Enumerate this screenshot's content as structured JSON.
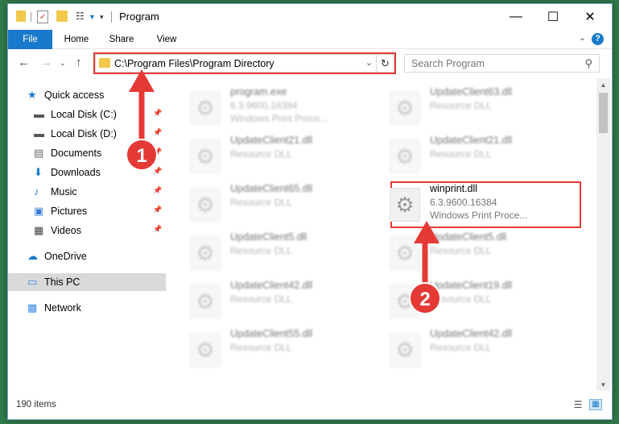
{
  "window": {
    "title": "Program"
  },
  "ribbon": {
    "tabs": [
      "File",
      "Home",
      "Share",
      "View"
    ]
  },
  "nav": {
    "address": "C:\\Program Files\\Program Directory",
    "search_placeholder": "Search Program"
  },
  "sidebar": {
    "items": [
      {
        "label": "Quick access",
        "icon": "star-icon",
        "pinned": false
      },
      {
        "label": "Local Disk (C:)",
        "icon": "drive-icon",
        "pinned": true
      },
      {
        "label": "Local Disk (D:)",
        "icon": "drive-icon",
        "pinned": true
      },
      {
        "label": "Documents",
        "icon": "documents-icon",
        "pinned": true
      },
      {
        "label": "Downloads",
        "icon": "download-icon",
        "pinned": true
      },
      {
        "label": "Music",
        "icon": "music-icon",
        "pinned": true
      },
      {
        "label": "Pictures",
        "icon": "pictures-icon",
        "pinned": true
      },
      {
        "label": "Videos",
        "icon": "videos-icon",
        "pinned": true
      },
      {
        "label": "OneDrive",
        "icon": "cloud-icon",
        "pinned": false
      },
      {
        "label": "This PC",
        "icon": "computer-icon",
        "pinned": false,
        "selected": true
      },
      {
        "label": "Network",
        "icon": "network-icon",
        "pinned": false
      }
    ]
  },
  "files": {
    "left": [
      {
        "name": "program.exe",
        "line1": "6.3.9600.16384",
        "line2": "Windows Print Proce..."
      },
      {
        "name": "UpdateClient21.dll",
        "line1": "Resource DLL"
      },
      {
        "name": "UpdateClient65.dll",
        "line1": "Resource DLL"
      },
      {
        "name": "UpdateClient5.dll",
        "line1": "Resource DLL"
      },
      {
        "name": "UpdateClient42.dll",
        "line1": "Resource DLL"
      },
      {
        "name": "UpdateClient55.dll",
        "line1": "Resource DLL"
      }
    ],
    "right": [
      {
        "name": "UpdateClient63.dll",
        "line1": "Resource DLL"
      },
      {
        "name": "UpdateClient21.dll",
        "line1": "Resource DLL"
      },
      {
        "name": "winprint.dll",
        "line1": "6.3.9600.16384",
        "line2": "Windows Print Proce..."
      },
      {
        "name": "UpdateClient5.dll",
        "line1": "Resource DLL"
      },
      {
        "name": "UpdateClient19.dll",
        "line1": "Resource DLL"
      },
      {
        "name": "UpdateClient42.dll",
        "line1": "Resource DLL"
      }
    ]
  },
  "status": {
    "count": "190 items"
  },
  "annotations": {
    "badge1": "1",
    "badge2": "2"
  },
  "colors": {
    "accent": "#1979ca",
    "highlight": "#e53935"
  }
}
